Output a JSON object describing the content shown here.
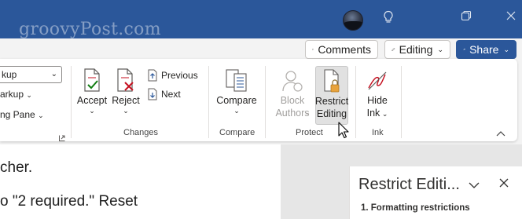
{
  "titlebar": {
    "watermark": "groovyPost.com",
    "lightbulb_icon": "lightbulb-icon",
    "restore_icon": "restore-window-icon"
  },
  "topbar": {
    "comments_label": "Comments",
    "editing_label": "Editing",
    "share_label": "Share"
  },
  "tracking": {
    "markup_combo": "kup",
    "show_markup": "arkup",
    "reviewing_pane": "ng Pane"
  },
  "changes": {
    "accept": "Accept",
    "reject": "Reject",
    "previous": "Previous",
    "next": "Next",
    "group": "Changes"
  },
  "compare": {
    "label": "Compare",
    "group": "Compare"
  },
  "protect": {
    "block_line1": "Block",
    "block_line2": "Authors",
    "restrict_line1": "Restrict",
    "restrict_line2": "Editing",
    "group": "Protect"
  },
  "ink": {
    "hide_line1": "Hide",
    "hide_line2": "Ink",
    "group": "Ink"
  },
  "document": {
    "line1": "cher.",
    "line2": "o \"2 required.\" Reset"
  },
  "pane": {
    "title": "Restrict Editi...",
    "section": "1. Formatting restrictions"
  },
  "colors": {
    "titlebar": "#2b579a",
    "accent": "#2b579a",
    "reject_red": "#c50f1f",
    "accept_green": "#107c10",
    "lock_orange": "#e8a33c"
  }
}
